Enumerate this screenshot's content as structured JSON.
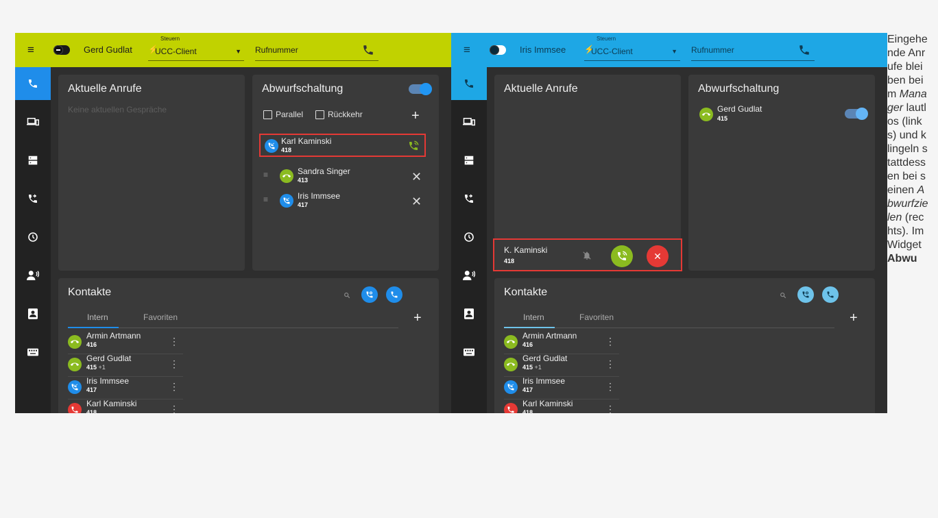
{
  "left": {
    "topbar": {
      "user_name": "Gerd Gudlat",
      "control_label": "Steuern",
      "control_value": "UCC-Client",
      "number_placeholder": "Rufnummer"
    },
    "current_calls": {
      "title": "Aktuelle Anrufe",
      "empty_text": "Keine aktuellen Gespräche"
    },
    "forwarding": {
      "title": "Abwurfschaltung",
      "parallel_label": "Parallel",
      "return_label": "Rückkehr",
      "incoming": {
        "name": "Karl Kaminski",
        "ext": "418"
      },
      "targets": [
        {
          "name": "Sandra Singer",
          "ext": "413"
        },
        {
          "name": "Iris Immsee",
          "ext": "417"
        }
      ]
    },
    "contacts": {
      "title": "Kontakte",
      "tabs": [
        "Intern",
        "Favoriten"
      ],
      "rows": [
        {
          "name": "Armin Artmann",
          "ext": "416",
          "extra": ""
        },
        {
          "name": "Gerd Gudlat",
          "ext": "415",
          "extra": "+1"
        },
        {
          "name": "Iris Immsee",
          "ext": "417",
          "extra": ""
        },
        {
          "name": "Karl Kaminski",
          "ext": "418",
          "extra": ""
        }
      ]
    }
  },
  "right": {
    "topbar": {
      "user_name": "Iris Immsee",
      "control_label": "Steuern",
      "control_value": "UCC-Client",
      "number_placeholder": "Rufnummer"
    },
    "current_calls": {
      "title": "Aktuelle Anrufe",
      "incoming_name": "K. Kaminski",
      "incoming_ext": "418"
    },
    "forwarding": {
      "title": "Abwurfschaltung",
      "entry_name": "Gerd Gudlat",
      "entry_ext": "415"
    },
    "contacts": {
      "title": "Kontakte",
      "tabs": [
        "Intern",
        "Favoriten"
      ],
      "rows": [
        {
          "name": "Armin Artmann",
          "ext": "416",
          "extra": ""
        },
        {
          "name": "Gerd Gudlat",
          "ext": "415",
          "extra": "+1"
        },
        {
          "name": "Iris Immsee",
          "ext": "417",
          "extra": ""
        },
        {
          "name": "Karl Kaminski",
          "ext": "418",
          "extra": ""
        }
      ]
    }
  },
  "note": {
    "p1": "Eingehende Anrufe bleiben beim",
    "manager": "Manager",
    "p2": "lautlos (links) und klingeln stattdessen bei seinen",
    "targets": "Abwurfzielen",
    "p3": "(rechts). Im Widget",
    "widget": "Abwu"
  },
  "colors": {
    "left_accent": "#c1d200",
    "right_accent": "#1ea7e5",
    "active_blue": "#1f8dea",
    "green": "#8bbb20",
    "red": "#e53935",
    "highlight": "#e53935"
  },
  "icons": [
    "menu-icon",
    "phone-icon",
    "devices-icon",
    "server-icon",
    "call-forward-icon",
    "history-icon",
    "voicemail-icon",
    "contacts-icon",
    "keyboard-icon",
    "bell-off-icon",
    "close-icon",
    "search-icon",
    "plus-icon",
    "kebab-icon"
  ]
}
